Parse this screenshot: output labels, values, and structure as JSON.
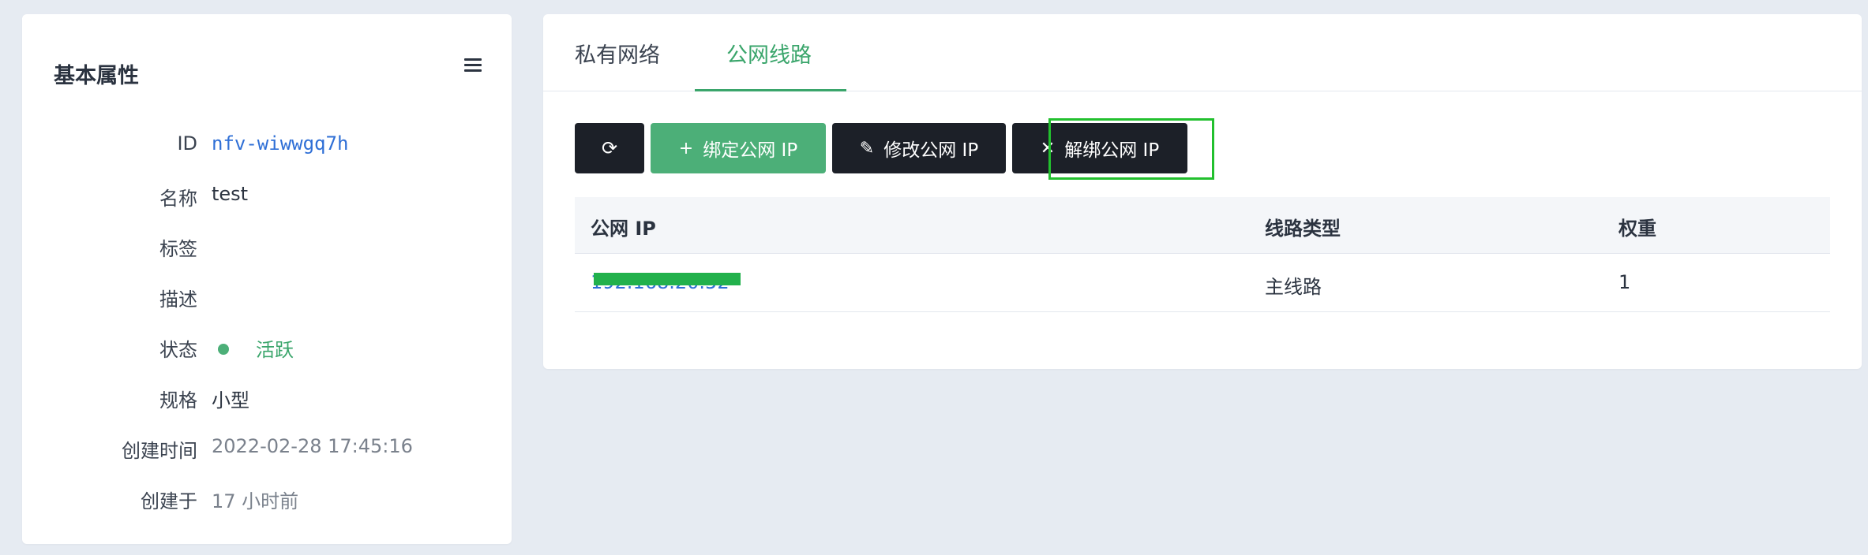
{
  "left": {
    "title": "基本属性",
    "menu_icon": "hamburger-menu-icon",
    "props": {
      "id": {
        "label": "ID",
        "value": "nfv-wiwwgq7h"
      },
      "name": {
        "label": "名称",
        "value": "test"
      },
      "tags": {
        "label": "标签",
        "value": ""
      },
      "desc": {
        "label": "描述",
        "value": ""
      },
      "status": {
        "label": "状态",
        "value": "活跃"
      },
      "spec": {
        "label": "规格",
        "value": "小型"
      },
      "created_time": {
        "label": "创建时间",
        "value": "2022-02-28 17:45:16"
      },
      "created_ago": {
        "label": "创建于",
        "value": "17 小时前"
      }
    }
  },
  "right": {
    "tabs": {
      "private_network": "私有网络",
      "public_line": "公网线路"
    },
    "active_tab": "公网线路",
    "toolbar": {
      "refresh_icon": "refresh-icon",
      "bind_label": "绑定公网 IP",
      "modify_label": "修改公网 IP",
      "unbind_label": "解绑公网 IP"
    },
    "table": {
      "headers": {
        "ip": "公网 IP",
        "line_type": "线路类型",
        "weight": "权重"
      },
      "rows": [
        {
          "ip": "192.168.20.52",
          "line_type": "主线路",
          "weight": "1"
        }
      ]
    }
  },
  "colors": {
    "accent_green": "#3aa56b",
    "dark_button": "#1c2028",
    "link_blue": "#2f6fd6",
    "highlight_border": "#22c02e"
  }
}
